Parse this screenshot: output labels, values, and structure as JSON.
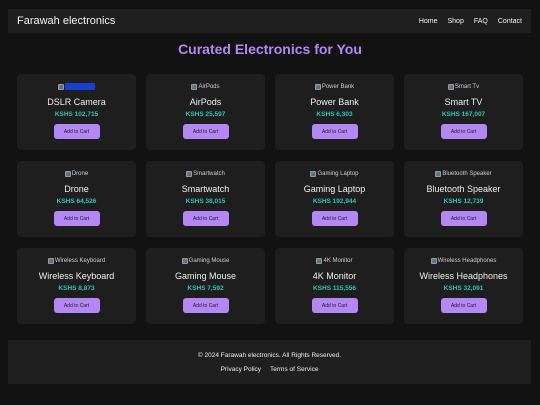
{
  "header": {
    "brand": "Farawah electronics",
    "nav": [
      "Home",
      "Shop",
      "FAQ",
      "Contact"
    ]
  },
  "main": {
    "title": "Curated Electronics for You",
    "products": [
      {
        "alt": "",
        "name": "DSLR Camera",
        "price": "KSHS 102,715",
        "button": "Add to Cart",
        "alt_is_link": true
      },
      {
        "alt": "AirPods",
        "name": "AirPods",
        "price": "KSHS 25,597",
        "button": "Add to Cart"
      },
      {
        "alt": "Power Bank",
        "name": "Power Bank",
        "price": "KSHS 6,303",
        "button": "Add to Cart"
      },
      {
        "alt": "Smart Tv",
        "name": "Smart TV",
        "price": "KSHS 167,007",
        "button": "Add to Cart"
      },
      {
        "alt": "Drone",
        "name": "Drone",
        "price": "KSHS 64,526",
        "button": "Add to Cart"
      },
      {
        "alt": "Smartwatch",
        "name": "Smartwatch",
        "price": "KSHS 38,015",
        "button": "Add to Cart"
      },
      {
        "alt": "Gaming Laptop",
        "name": "Gaming Laptop",
        "price": "KSHS 192,944",
        "button": "Add to Cart"
      },
      {
        "alt": "Bluetooth Speaker",
        "name": "Bluetooth Speaker",
        "price": "KSHS 12,739",
        "button": "Add to Cart"
      },
      {
        "alt": "Wireless Keyboard",
        "name": "Wireless Keyboard",
        "price": "KSHS 8,873",
        "button": "Add to Cart"
      },
      {
        "alt": "Gaming Mouse",
        "name": "Gaming Mouse",
        "price": "KSHS 7,592",
        "button": "Add to Cart"
      },
      {
        "alt": "4K Monitor",
        "name": "4K Monitor",
        "price": "KSHS 115,556",
        "button": "Add to Cart"
      },
      {
        "alt": "Wireless Headphones",
        "name": "Wireless Headphones",
        "price": "KSHS 32,091",
        "button": "Add to Cart"
      }
    ]
  },
  "footer": {
    "copyright": "© 2024 Farawah electronics. All Rights Reserved.",
    "links": [
      "Privacy Policy",
      "Terms of Service"
    ]
  },
  "colors": {
    "background": "#121212",
    "surface": "#1e1e1e",
    "accent": "#b388f5",
    "price": "#2ec4b6"
  },
  "icons": {
    "product_image": "broken-image-icon"
  }
}
